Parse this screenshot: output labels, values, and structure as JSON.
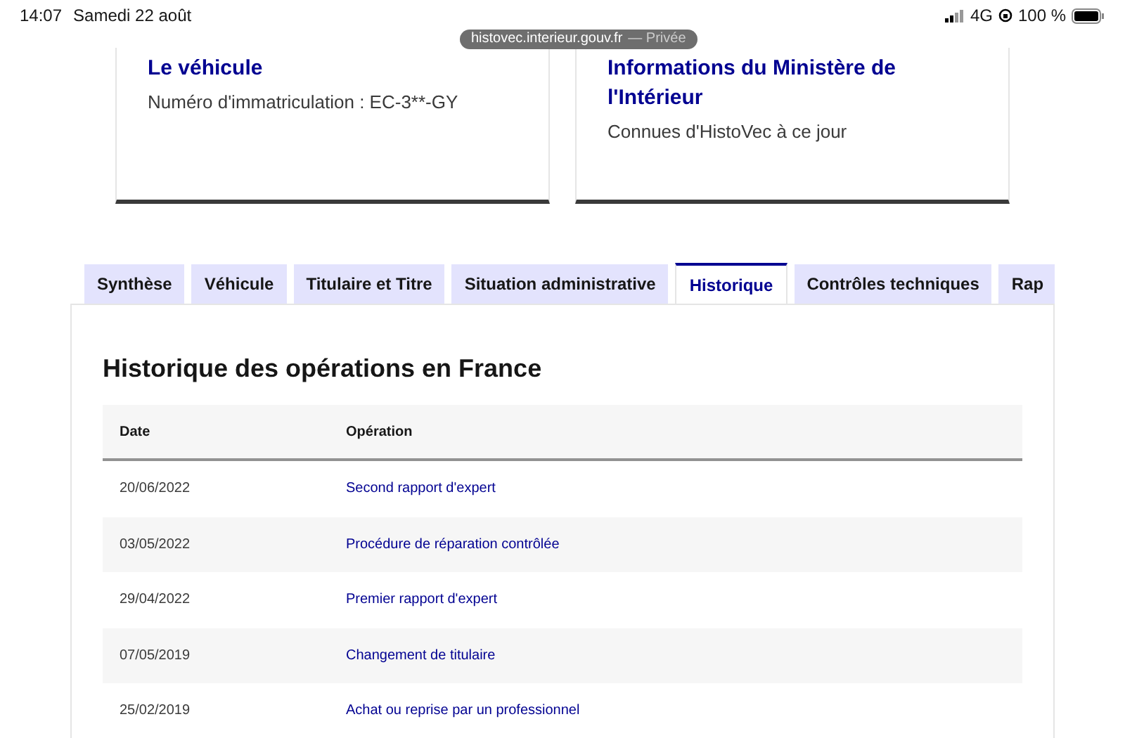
{
  "status_bar": {
    "time": "14:07",
    "date": "Samedi 22 août",
    "network": "4G",
    "battery": "100 %"
  },
  "url_bar": {
    "domain": "histovec.interieur.gouv.fr",
    "mode": "— Privée"
  },
  "cards": [
    {
      "title": "Le véhicule",
      "text": "Numéro d'immatriculation : EC-3**-GY"
    },
    {
      "title": "Informations du Ministère de l'Intérieur",
      "text": "Connues d'HistoVec à ce jour"
    }
  ],
  "tabs": [
    {
      "label": "Synthèse",
      "selected": false
    },
    {
      "label": "Véhicule",
      "selected": false
    },
    {
      "label": "Titulaire et Titre",
      "selected": false
    },
    {
      "label": "Situation administrative",
      "selected": false
    },
    {
      "label": "Historique",
      "selected": true
    },
    {
      "label": "Contrôles techniques",
      "selected": false
    },
    {
      "label": "Rap",
      "selected": false
    }
  ],
  "section_title": "Historique des opérations en France",
  "table": {
    "columns": [
      "Date",
      "Opération"
    ],
    "rows": [
      {
        "date": "20/06/2022",
        "operation": "Second rapport d'expert"
      },
      {
        "date": "03/05/2022",
        "operation": "Procédure de réparation contrôlée"
      },
      {
        "date": "29/04/2022",
        "operation": "Premier rapport d'expert"
      },
      {
        "date": "07/05/2019",
        "operation": "Changement de titulaire"
      },
      {
        "date": "25/02/2019",
        "operation": "Achat ou reprise par un professionnel"
      }
    ]
  }
}
